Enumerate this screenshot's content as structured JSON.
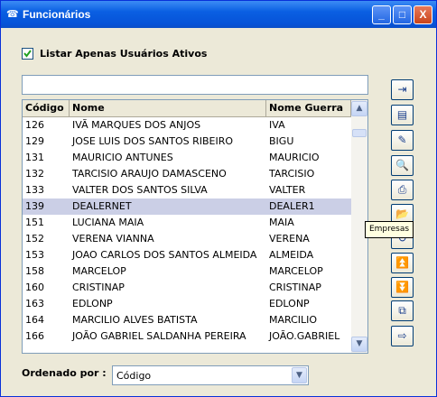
{
  "window": {
    "title": "Funcionários",
    "icon": "phone-icon",
    "controls": {
      "minimize": "_",
      "maximize": "□",
      "close": "X"
    }
  },
  "filter": {
    "checkbox_label": "Listar Apenas Usuários Ativos",
    "checked": true,
    "search_value": ""
  },
  "grid": {
    "columns": [
      "Código",
      "Nome",
      "Nome Guerra"
    ],
    "rows": [
      {
        "codigo": "126",
        "nome": "IVÃ MARQUES DOS ANJOS",
        "guerra": "IVA"
      },
      {
        "codigo": "129",
        "nome": "JOSE LUIS DOS SANTOS RIBEIRO",
        "guerra": "BIGU"
      },
      {
        "codigo": "131",
        "nome": "MAURICIO ANTUNES",
        "guerra": "MAURICIO"
      },
      {
        "codigo": "132",
        "nome": "TARCISIO ARAUJO DAMASCENO",
        "guerra": "TARCISIO"
      },
      {
        "codigo": "133",
        "nome": "VALTER DOS SANTOS SILVA",
        "guerra": "VALTER"
      },
      {
        "codigo": "139",
        "nome": "DEALERNET",
        "guerra": "DEALER1"
      },
      {
        "codigo": "151",
        "nome": "LUCIANA MAIA",
        "guerra": "MAIA"
      },
      {
        "codigo": "152",
        "nome": "VERENA VIANNA",
        "guerra": "VERENA"
      },
      {
        "codigo": "153",
        "nome": "JOAO CARLOS DOS SANTOS ALMEIDA",
        "guerra": "ALMEIDA"
      },
      {
        "codigo": "158",
        "nome": "MARCELOP",
        "guerra": "MARCELOP"
      },
      {
        "codigo": "160",
        "nome": "CRISTINAP",
        "guerra": "CRISTINAP"
      },
      {
        "codigo": "163",
        "nome": "EDLONP",
        "guerra": "EDLONP"
      },
      {
        "codigo": "164",
        "nome": "MARCILIO ALVES BATISTA",
        "guerra": "MARCILIO"
      },
      {
        "codigo": "166",
        "nome": "JOÃO GABRIEL SALDANHA PEREIRA",
        "guerra": "JOÃO.GABRIEL"
      }
    ],
    "selected_codigo": "139"
  },
  "toolbar": {
    "buttons": [
      {
        "name": "insert-record-icon",
        "glyph": "⇥"
      },
      {
        "name": "edit-record-icon",
        "glyph": "▤"
      },
      {
        "name": "eraser-icon",
        "glyph": "✎"
      },
      {
        "name": "print-preview-icon",
        "glyph": "🔍"
      },
      {
        "name": "printer-icon",
        "glyph": "⎙"
      },
      {
        "name": "folder-icon",
        "glyph": "📂"
      },
      {
        "name": "refresh-icon",
        "glyph": "↻"
      },
      {
        "name": "first-record-icon",
        "glyph": "⏫"
      },
      {
        "name": "last-record-icon",
        "glyph": "⏬"
      },
      {
        "name": "copy-icon",
        "glyph": "⧉"
      },
      {
        "name": "exit-icon",
        "glyph": "⇨"
      }
    ],
    "tooltip": "Empresas"
  },
  "order": {
    "label": "Ordenado por :",
    "value": "Código"
  },
  "colors": {
    "title_bar": "#0a5fe2",
    "selected_row": "#cbcfe6",
    "window_bg": "#ece9d8"
  }
}
